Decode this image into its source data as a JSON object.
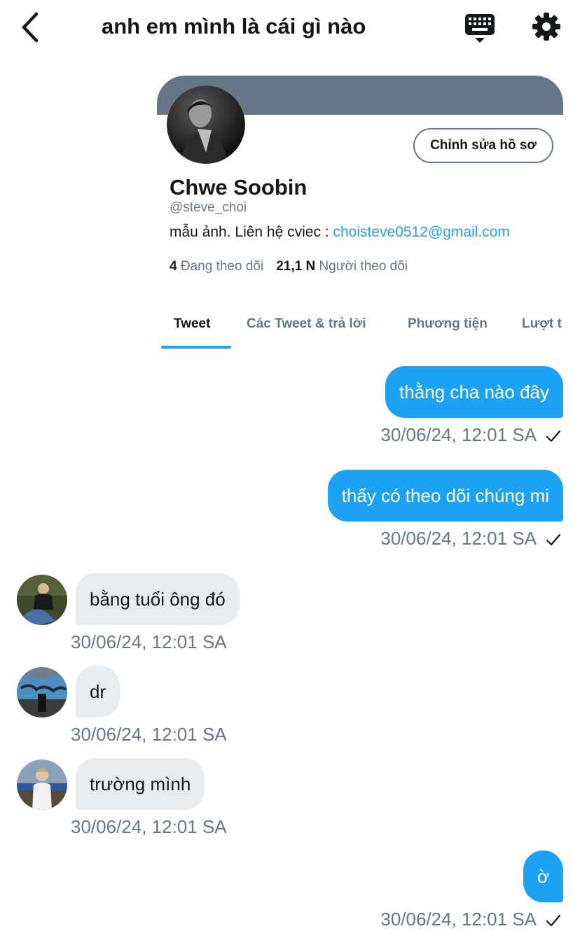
{
  "header": {
    "title": "anh em mình là cái gì nào",
    "icons": {
      "back": "chevron-left-icon",
      "keyboard": "keyboard-icon",
      "settings": "gear-icon"
    }
  },
  "profile": {
    "name": "Chwe Soobin",
    "handle": "@steve_choi",
    "bio_text": "mẫu ảnh. Liên hệ cviec : ",
    "bio_email": "choisteve0512@gmail.com",
    "edit_button": "Chỉnh sửa hồ sơ",
    "following_count": "4",
    "following_label": "Đang theo dõi",
    "followers_count": "21,1 N",
    "followers_label": "Người theo dõi",
    "tabs": [
      "Tweet",
      "Các Tweet & trả lời",
      "Phương tiện",
      "Lượt t"
    ],
    "active_tab": "Tweet"
  },
  "messages": [
    {
      "direction": "out",
      "text": "thằng cha nào đây",
      "time": "30/06/24, 12:01 SA",
      "read": true
    },
    {
      "direction": "out",
      "text": "thấy có theo dõi chúng mi",
      "time": "30/06/24, 12:01 SA",
      "read": true
    },
    {
      "direction": "in",
      "text": "bằng tuổi ông đó",
      "time": "30/06/24, 12:01 SA"
    },
    {
      "direction": "in",
      "text": "dr",
      "time": "30/06/24, 12:01 SA"
    },
    {
      "direction": "in",
      "text": "trường mình",
      "time": "30/06/24, 12:01 SA"
    },
    {
      "direction": "out",
      "text": "ờ",
      "time": "30/06/24, 12:01 SA",
      "read": true
    }
  ],
  "colors": {
    "accent": "#1da1f2",
    "banner": "#657786",
    "incoming_bubble": "#e6ecf0",
    "muted_text": "#657786"
  }
}
